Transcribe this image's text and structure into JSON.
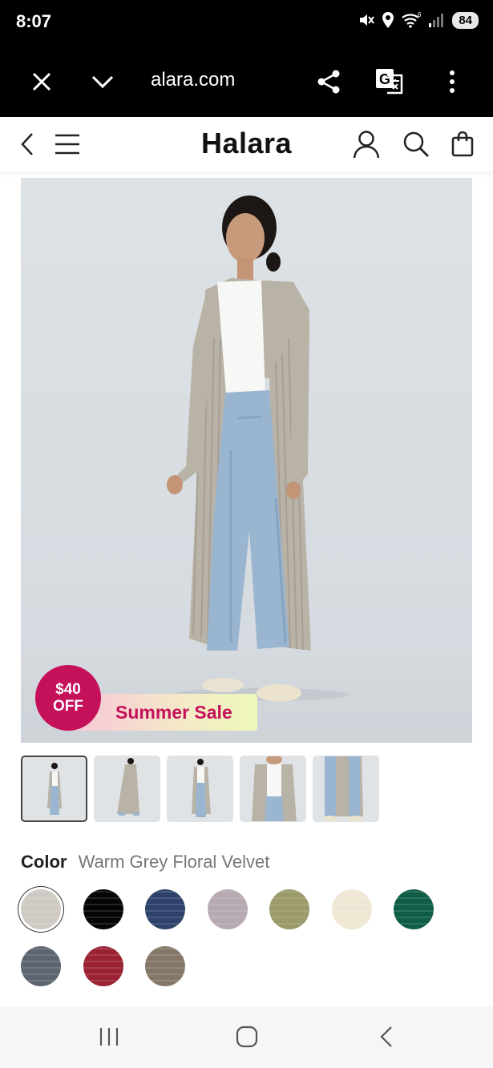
{
  "status": {
    "time": "8:07",
    "battery": "84",
    "network_label": "6"
  },
  "browser": {
    "url": "alara.com",
    "icons": [
      "close-icon",
      "chevron-down-icon",
      "share-icon",
      "translate-icon",
      "more-vertical-icon"
    ]
  },
  "header": {
    "logo": "Halara",
    "icons": [
      "back-icon",
      "menu-icon",
      "account-icon",
      "search-icon",
      "bag-icon"
    ]
  },
  "promo": {
    "discount_line1": "$40",
    "discount_line2": "OFF",
    "sale_label": "Summer Sale",
    "accent_color": "#c5105a"
  },
  "thumbnails": {
    "count": 5,
    "selected_index": 0
  },
  "color": {
    "label": "Color",
    "selected_name": "Warm Grey Floral Velvet",
    "swatches": [
      {
        "name": "Warm Grey Floral Velvet",
        "color": "#cfcac3",
        "selected": true
      },
      {
        "name": "Black",
        "color": "#050505",
        "selected": false
      },
      {
        "name": "Navy",
        "color": "#2e426b",
        "selected": false
      },
      {
        "name": "Lilac Grey",
        "color": "#b6a9b1",
        "selected": false
      },
      {
        "name": "Olive",
        "color": "#9a9a6a",
        "selected": false
      },
      {
        "name": "Cream",
        "color": "#efe7d4",
        "selected": false
      },
      {
        "name": "Green",
        "color": "#0f5d46",
        "selected": false
      },
      {
        "name": "Charcoal Blue",
        "color": "#5d6670",
        "selected": false
      },
      {
        "name": "Burgundy",
        "color": "#9a2233",
        "selected": false
      },
      {
        "name": "Taupe",
        "color": "#857768",
        "selected": false
      }
    ]
  },
  "system_nav": {
    "icons": [
      "recent-apps-icon",
      "home-icon",
      "back-nav-icon"
    ]
  }
}
